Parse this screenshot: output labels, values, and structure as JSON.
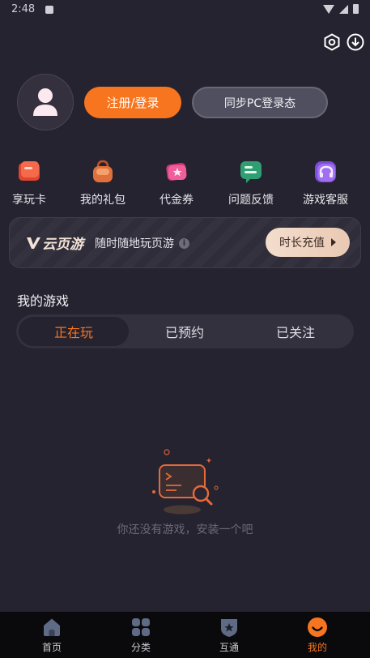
{
  "status_bar": {
    "time": "2:48"
  },
  "header": {
    "settings_icon": "settings-icon",
    "download_icon": "download-icon"
  },
  "profile": {
    "avatar_icon": "user-icon",
    "login_label": "注册/登录",
    "sync_label": "同步PC登录态"
  },
  "shortcuts": [
    {
      "label": "享玩卡",
      "icon": "card-icon"
    },
    {
      "label": "我的礼包",
      "icon": "gift-bag-icon"
    },
    {
      "label": "代金券",
      "icon": "voucher-icon"
    },
    {
      "label": "问题反馈",
      "icon": "feedback-icon"
    },
    {
      "label": "游戏客服",
      "icon": "headset-icon"
    }
  ],
  "cloud_banner": {
    "brand": "云页游",
    "tagline": "随时随地玩页游",
    "info_glyph": "i",
    "recharge_label": "时长充值"
  },
  "my_games": {
    "title": "我的游戏",
    "tabs": [
      {
        "label": "正在玩",
        "active": true
      },
      {
        "label": "已预约",
        "active": false
      },
      {
        "label": "已关注",
        "active": false
      }
    ],
    "empty_text": "你还没有游戏，安装一个吧"
  },
  "bottom_nav": [
    {
      "label": "首页",
      "icon": "home-icon",
      "active": false
    },
    {
      "label": "分类",
      "icon": "grid-icon",
      "active": false
    },
    {
      "label": "互通",
      "icon": "shield-icon",
      "active": false
    },
    {
      "label": "我的",
      "icon": "smile-icon",
      "active": true
    }
  ],
  "colors": {
    "accent": "#f7751f",
    "background": "#25232f",
    "nav_background": "#0a0a0d"
  }
}
